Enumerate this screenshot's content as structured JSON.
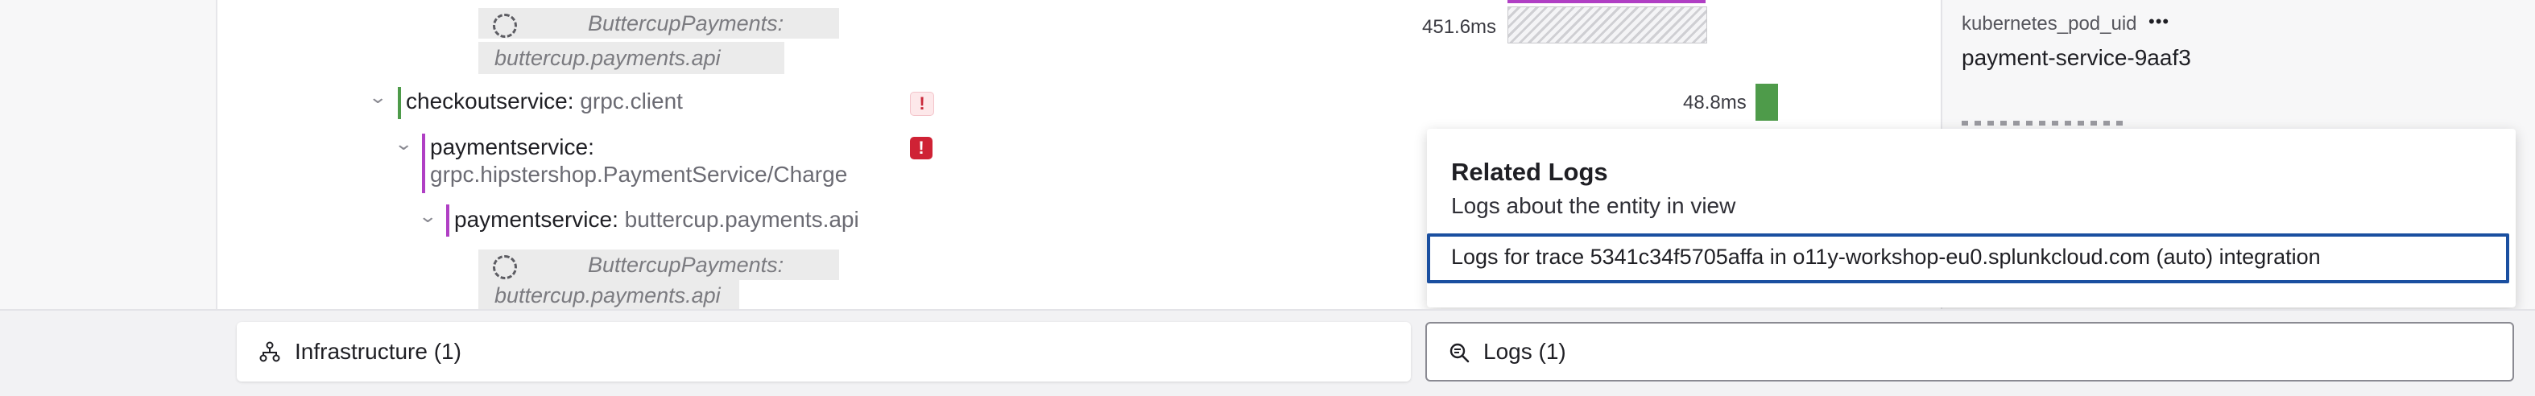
{
  "trace": {
    "rows": [
      {
        "placeholder_line1": "ButtercupPayments:",
        "placeholder_line2": "buttercup.payments.api",
        "duration": "451.6ms"
      },
      {
        "service": "checkoutservice:",
        "operation": "grpc.client",
        "duration": "48.8ms",
        "warning": "!"
      },
      {
        "service": "paymentservice:",
        "operation": "grpc.hipstershop.PaymentService/Charge",
        "warning": "!"
      },
      {
        "service": "paymentservice:",
        "operation": "buttercup.payments.api"
      },
      {
        "placeholder_line1": "ButtercupPayments:",
        "placeholder_line2": "buttercup.payments.api"
      }
    ]
  },
  "sidebar": {
    "tag_key": "kubernetes_pod_uid",
    "more": "•••",
    "tag_value": "payment-service-9aaf3"
  },
  "popover": {
    "title": "Related Logs",
    "subtitle": "Logs about the entity in view",
    "link": "Logs for trace 5341c34f5705affa in o11y-workshop-eu0.splunkcloud.com (auto) integration"
  },
  "bottom_tabs": {
    "infrastructure": "Infrastructure (1)",
    "logs": "Logs (1)"
  },
  "colors": {
    "checkout_accent": "#4e9b4a",
    "payment_accent": "#b03fc4",
    "selected_border": "#1a4fa0"
  }
}
